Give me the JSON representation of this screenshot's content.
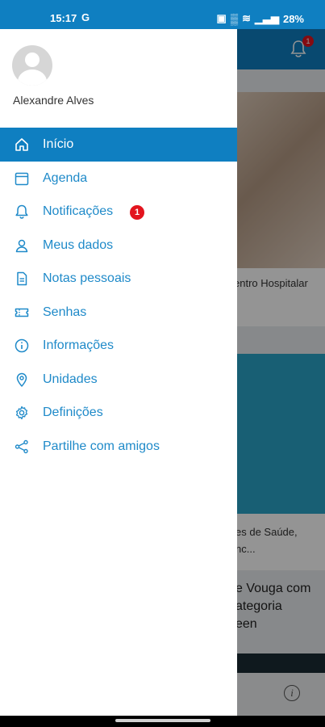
{
  "status_bar": {
    "time": "15:17",
    "carrier_icon": "G",
    "battery": "28%"
  },
  "drawer": {
    "user_name": "Alexandre Alves",
    "menu": [
      {
        "label": "Início",
        "icon": "home-icon",
        "active": true
      },
      {
        "label": "Agenda",
        "icon": "calendar-icon"
      },
      {
        "label": "Notificações",
        "icon": "bell-icon",
        "badge": "1"
      },
      {
        "label": "Meus dados",
        "icon": "person-icon"
      },
      {
        "label": "Notas pessoais",
        "icon": "document-icon"
      },
      {
        "label": "Senhas",
        "icon": "ticket-icon"
      },
      {
        "label": "Informações",
        "icon": "info-icon"
      },
      {
        "label": "Unidades",
        "icon": "location-pin-icon"
      },
      {
        "label": "Definições",
        "icon": "gear-icon"
      },
      {
        "label": "Partilhe com amigos",
        "icon": "share-icon"
      }
    ]
  },
  "background": {
    "notification_badge": "1",
    "card1_caption": "entro Hospitalar",
    "card2_caption_line1": "es de Saúde,",
    "card2_caption_line2": "nc...",
    "news_title_line1": "e Vouga com",
    "news_title_line2": "ategoria",
    "news_title_line3": "een"
  },
  "colors": {
    "primary": "#0f7fc1",
    "menu_text": "#1f8ac9",
    "badge": "#e3141e"
  }
}
